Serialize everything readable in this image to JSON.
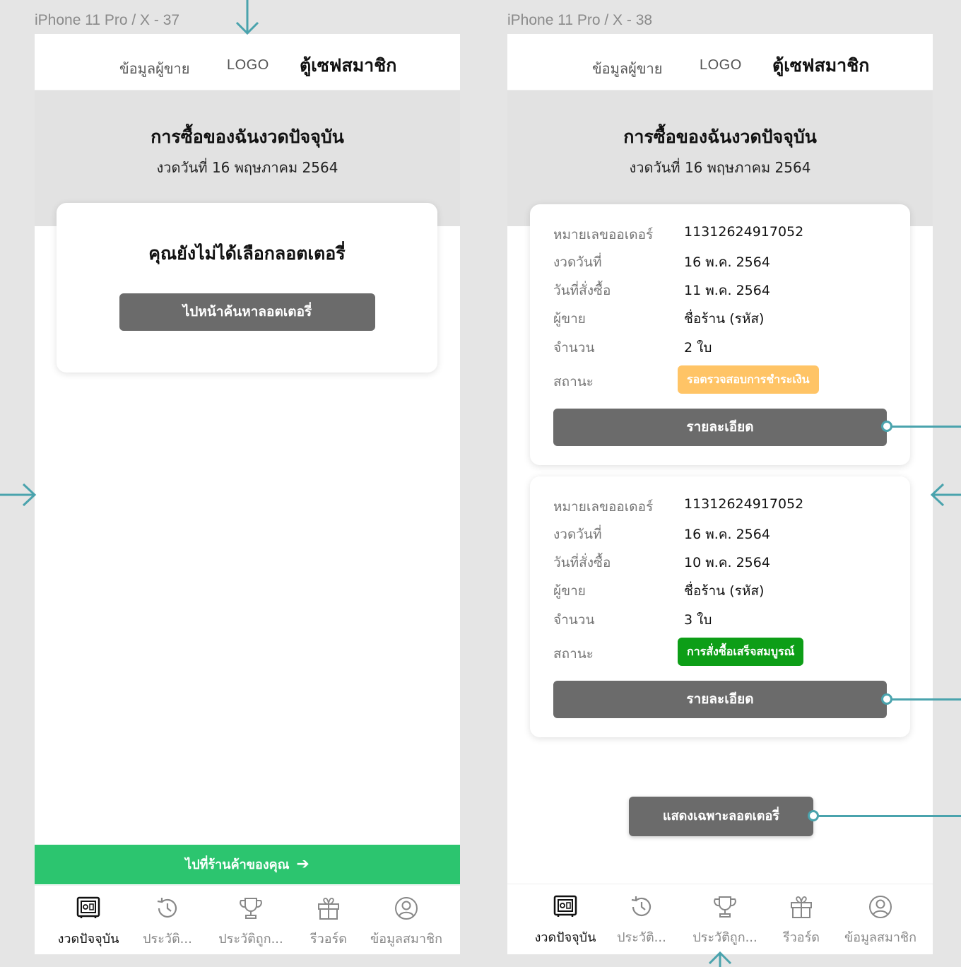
{
  "frames": [
    {
      "label": "iPhone 11 Pro / X - 37",
      "topbar": {
        "seller": "ข้อมูลผู้ขาย",
        "logo": "LOGO",
        "title": "ตู้เซฟสมาชิก"
      },
      "hero": {
        "title": "การซื้อของฉันงวดปัจจุบัน",
        "date": "งวดวันที่ 16 พฤษภาคม 2564"
      },
      "empty": {
        "message": "คุณยังไม่ได้เลือกลอตเตอรี่",
        "button": "ไปหน้าค้นหาลอตเตอรี่"
      },
      "shop_button": "ไปที่ร้านค้าของคุณ",
      "tabs": [
        "งวดปัจจุบัน",
        "ประวัติ...",
        "ประวัติถูก...",
        "รีวอร์ด",
        "ข้อมูลสมาชิก"
      ]
    },
    {
      "label": "iPhone 11 Pro / X - 38",
      "topbar": {
        "seller": "ข้อมูลผู้ขาย",
        "logo": "LOGO",
        "title": "ตู้เซฟสมาชิก"
      },
      "hero": {
        "title": "การซื้อของฉันงวดปัจจุบัน",
        "date": "งวดวันที่ 16 พฤษภาคม 2564"
      },
      "field_labels": {
        "order_no": "หมายเลขออเดอร์",
        "draw_date": "งวดวันที่",
        "order_date": "วันที่สั่งซื้อ",
        "seller": "ผู้ขาย",
        "quantity": "จำนวน",
        "status": "สถานะ"
      },
      "orders": [
        {
          "order_no": "11312624917052",
          "draw_date": "16 พ.ค. 2564",
          "order_date": "11 พ.ค. 2564",
          "seller": "ชื่อร้าน (รหัส)",
          "quantity": "2 ใบ",
          "status": "รอตรวจสอบการชำระเงิน",
          "status_color": "#ffc466",
          "detail_button": "รายละเอียด"
        },
        {
          "order_no": "11312624917052",
          "draw_date": "16 พ.ค. 2564",
          "order_date": "10 พ.ค. 2564",
          "seller": "ชื่อร้าน (รหัส)",
          "quantity": "3 ใบ",
          "status": "การสั่งซื้อเสร็จสมบูรณ์",
          "status_color": "#0d9e17",
          "detail_button": "รายละเอียด"
        }
      ],
      "filter_button": "แสดงเฉพาะลอตเตอรี่",
      "tabs": [
        "งวดปัจจุบัน",
        "ประวัติ...",
        "ประวัติถูก...",
        "รีวอร์ด",
        "ข้อมูลสมาชิก"
      ]
    }
  ],
  "colors": {
    "accent": "#2cc56f",
    "prototype_link": "#4aa3ad",
    "button": "#6b6b6b"
  },
  "tab_icons": [
    "safe-icon",
    "history-icon",
    "trophy-icon",
    "gift-icon",
    "user-icon"
  ]
}
